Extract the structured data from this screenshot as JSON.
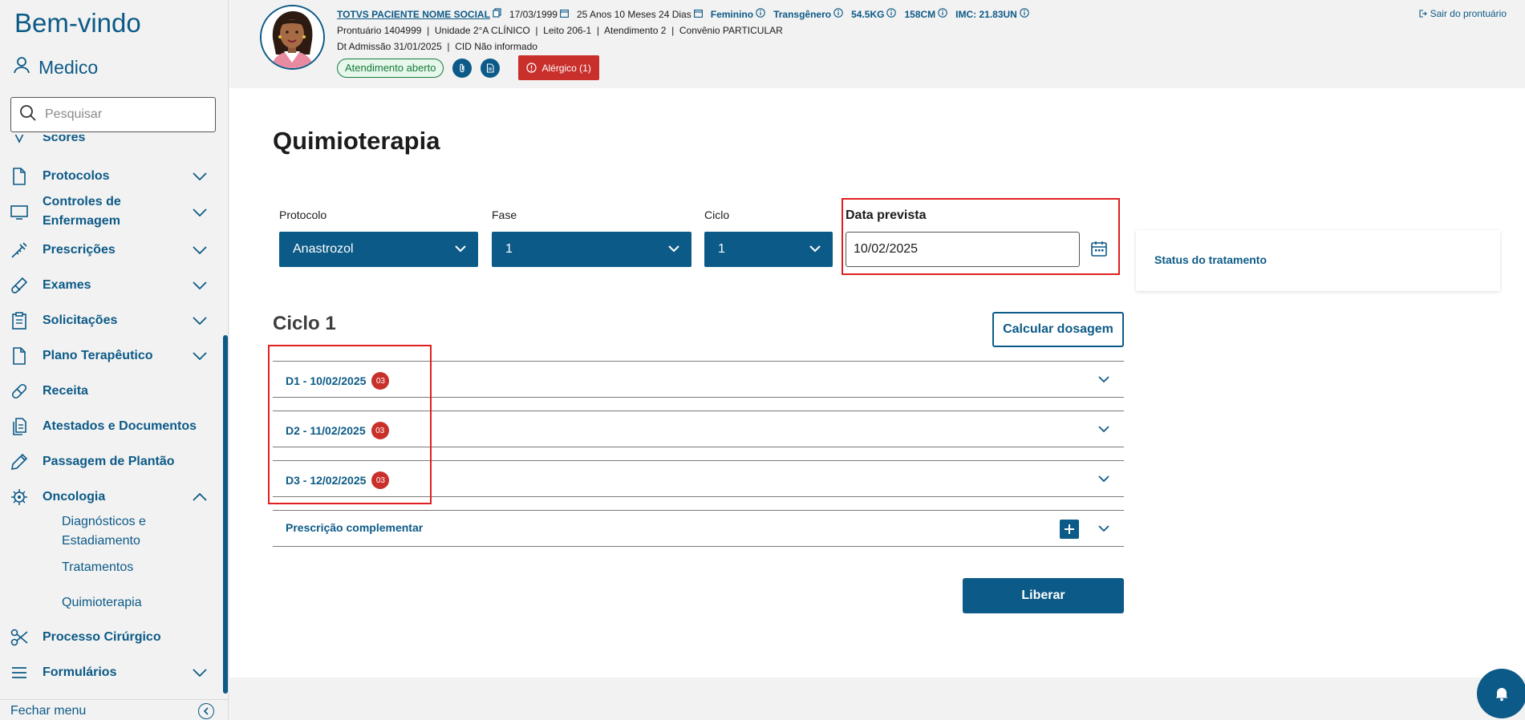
{
  "sidebar": {
    "welcome": "Bem-vindo",
    "user": "Medico",
    "search_placeholder": "Pesquisar",
    "items": [
      {
        "label": "Scores",
        "icon": "scores-icon"
      },
      {
        "label": "Protocolos",
        "icon": "document-icon"
      },
      {
        "label": "Controles de Enfermagem",
        "icon": "monitor-icon"
      },
      {
        "label": "Prescrições",
        "icon": "syringe-icon"
      },
      {
        "label": "Exames",
        "icon": "flask-icon"
      },
      {
        "label": "Solicitações",
        "icon": "clipboard-icon"
      },
      {
        "label": "Plano Terapêutico",
        "icon": "document-icon"
      },
      {
        "label": "Receita",
        "icon": "pill-icon"
      },
      {
        "label": "Atestados e Documentos",
        "icon": "documents-icon"
      },
      {
        "label": "Passagem de Plantão",
        "icon": "pencil-icon"
      },
      {
        "label": "Oncologia",
        "icon": "virus-icon"
      },
      {
        "label": "Processo Cirúrgico",
        "icon": "scissors-icon"
      },
      {
        "label": "Formulários",
        "icon": "list-icon"
      }
    ],
    "oncologia_sub": [
      "Diagnósticos e Estadiamento",
      "Tratamentos",
      "Quimioterapia"
    ],
    "footer_label": "Fechar menu"
  },
  "header": {
    "patient_name": "TOTVS PACIENTE NOME SOCIAL",
    "birth_date": "17/03/1999",
    "age": "25 Anos 10 Meses 24 Dias",
    "sex": "Feminino",
    "gender": "Transgênero",
    "weight": "54.5KG",
    "height": "158CM",
    "imc": "IMC: 21.83UN",
    "row2": "Prontuário 1404999  |  Unidade 2°A CLÍNICO  |  Leito 206-1  |  Atendimento 2  |  Convênio PARTICULAR",
    "row3": "Dt Admissão 31/01/2025  |  CID Não informado",
    "status_pill": "Atendimento aberto",
    "allergy": "Alérgico (1)",
    "logout": "Sair do prontuário"
  },
  "main": {
    "title": "Quimioterapia",
    "protocolo_label": "Protocolo",
    "protocolo_value": "Anastrozol",
    "fase_label": "Fase",
    "fase_value": "1",
    "ciclo_label": "Ciclo",
    "ciclo_value": "1",
    "data_label": "Data prevista",
    "data_value": "10/02/2025",
    "status_title": "Status do tratamento",
    "ciclo_title": "Ciclo 1",
    "calc_button": "Calcular dosagem",
    "days": [
      {
        "label": "D1 - 10/02/2025",
        "badge": "03"
      },
      {
        "label": "D2 - 11/02/2025",
        "badge": "03"
      },
      {
        "label": "D3 - 12/02/2025",
        "badge": "03"
      }
    ],
    "complementar": "Prescrição complementar",
    "liberar": "Liberar"
  },
  "colors": {
    "primary": "#0c5a87",
    "danger": "#c9302c",
    "highlight": "#e02020",
    "success": "#147a3b"
  }
}
